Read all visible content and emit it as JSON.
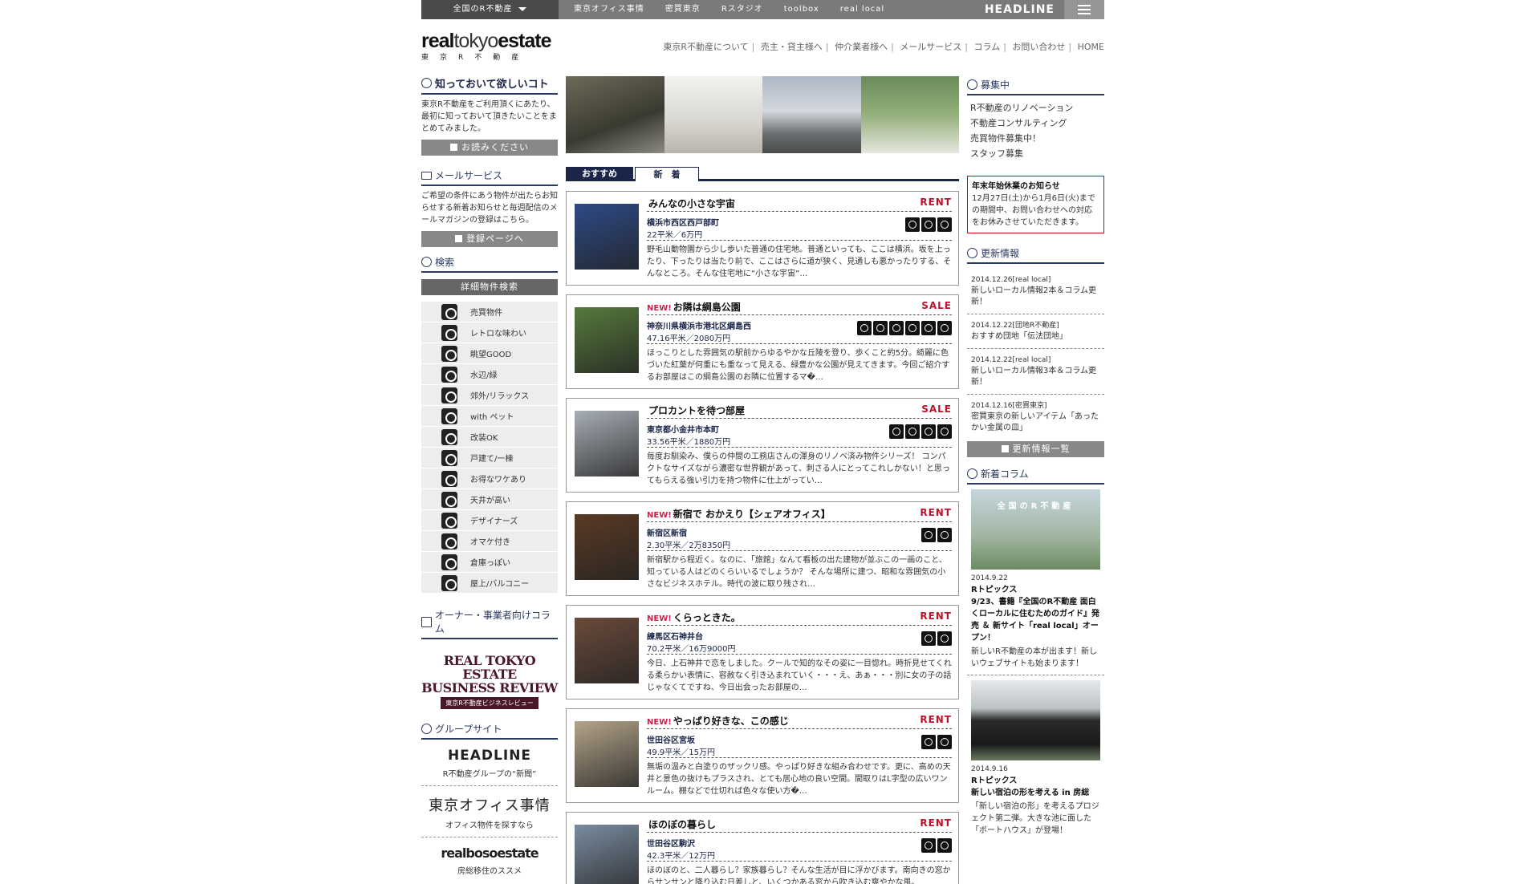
{
  "topbar": {
    "region": "全国のR不動産",
    "links": [
      "東京オフィス事情",
      "密買東京",
      "Rスタジオ",
      "toolbox",
      "real local"
    ],
    "headline": "HEADLINE"
  },
  "logo": {
    "main_bold": "real",
    "main_light": "tokyo",
    "main_bold2": "estate",
    "sub": "東京R不動産"
  },
  "gnav": [
    "東京R不動産について",
    "売主・貸主様へ",
    "仲介業者様へ",
    "メールサービス",
    "コラム",
    "お問い合わせ",
    "HOME"
  ],
  "left": {
    "know_title": "知っておいて欲しいコト",
    "know_text": "東京R不動産をご利用頂くにあたり、最初に知っておいて頂きたいことをまとめてみました。",
    "know_btn": "お読みください",
    "mail_title": "メールサービス",
    "mail_text": "ご希望の条件にあう物件が出たらお知らせする新着お知らせと毎週配信のメールマガジンの登録はこちら。",
    "mail_btn": "登録ページへ",
    "search_title": "検索",
    "search_btn": "詳細物件検索",
    "categories": [
      "売買物件",
      "レトロな味わい",
      "眺望GOOD",
      "水辺/緑",
      "郊外/リラックス",
      "with ペット",
      "改装OK",
      "戸建て/一棟",
      "お得なワケあり",
      "天井が高い",
      "デザイナーズ",
      "オマケ付き",
      "倉庫っぽい",
      "屋上/バルコニー"
    ],
    "owner_title": "オーナー・事業者向けコラム",
    "br_t1": "REAL TOKYO ESTATE",
    "br_t2": "BUSINESS REVIEW",
    "br_t3": "東京R不動産ビジネスレビュー",
    "group_title": "グループサイト",
    "groups": [
      {
        "name": "HEADLINE",
        "sub": "R不動産グループの“新聞”"
      },
      {
        "name": "東京オフィス事情",
        "sub": "オフィス物件を探すなら"
      },
      {
        "name": "realbosoestate",
        "sub": "房総移住のススメ"
      }
    ]
  },
  "tabs": {
    "recommend": "おすすめ",
    "new": "新　着"
  },
  "listings": [
    {
      "new": "",
      "title": "みんなの小さな宇宙",
      "kind": "RENT",
      "loc": "横浜市西区西戸部町",
      "price": "22平米／6万円",
      "icons": 3,
      "desc": "野毛山動物園から少し歩いた普通の住宅地。普通といっても、ここは横浜。坂を上ったり、下ったりは当たり前で、ここはさらに道が狭く、見通しも悪かったりする、そんなところ。そんな住宅地に“小さな宇宙”…",
      "thumb": "#2d4a86"
    },
    {
      "new": "NEW!",
      "title": "お隣は綱島公園",
      "kind": "SALE",
      "loc": "神奈川県横浜市港北区綱島西",
      "price": "47.16平米／2080万円",
      "icons": 6,
      "desc": "ほっこりとした雰囲気の駅前からゆるやかな丘陵を登り、歩くこと約5分。綺麗に色づいた紅葉が何重にも重なって見える、緑豊かな公園が見えてきます。今回ご紹介するお部屋はこの綱島公園のお隣に位置するマ�…",
      "thumb": "#567a3c"
    },
    {
      "new": "",
      "title": "プロカントを待つ部屋",
      "kind": "SALE",
      "loc": "東京都小金井市本町",
      "price": "33.56平米／1880万円",
      "icons": 4,
      "desc": "毎度お馴染み、僕らの仲間の工務店さんの渾身のリノベ済み物件シリーズ！ コンパクトなサイズながら濃密な世界観があって、刺さる人にとってこれしかない！と思ってもらえる強い引力を持つ物件に仕上がってい…",
      "thumb": "#a8aeb6"
    },
    {
      "new": "NEW!",
      "title": "新宿で おかえり【シェアオフィス】",
      "kind": "RENT",
      "loc": "新宿区新宿",
      "price": "2.30平米／2万8350円",
      "icons": 2,
      "desc": "新宿駅から程近く。なのに、「旅館」なんて看板の出た建物が並ぶこの一画のこと、知っている人はどのくらいいるでしょうか？ そんな場所に建つ、昭和な雰囲気の小さなビジネスホテル。時代の波に取り残され…",
      "thumb": "#5a3a24"
    },
    {
      "new": "NEW!",
      "title": "くらっときた。",
      "kind": "RENT",
      "loc": "練馬区石神井台",
      "price": "70.2平米／16万9000円",
      "icons": 2,
      "desc": "今日、上石神井で恋をしました。クールで知的なその姿に一目惚れ。時折見せてくれる柔らかい表情に、容赦なく引き込まれていく・・・え、あぁ・・・別に女の子の話じゃなくてですね、今日出会ったお部屋の…",
      "thumb": "#6a4a3a"
    },
    {
      "new": "NEW!",
      "title": "やっぱり好きな、この感じ",
      "kind": "RENT",
      "loc": "世田谷区宮坂",
      "price": "49.9平米／15万円",
      "icons": 2,
      "desc": "無垢の温みと白塗りのザックリ感。やっぱり好きな組み合わせです。更に、高めの天井と景色の抜けもプラスされ、とても居心地の良い空間。間取りはL字型の広いワンルーム。棚などで仕切れば色々な使い方�…",
      "thumb": "#b4a48a"
    },
    {
      "new": "",
      "title": "ほのぼの暮らし",
      "kind": "RENT",
      "loc": "世田谷区駒沢",
      "price": "42.3平米／12万円",
      "icons": 2,
      "desc": "ほのぼのと、二人暮らし？家族暮らし？そんな生活が目に浮かびます。南向きの窓からサンサンと降り込む日差しと、いくつかある窓から吹き込む爽やかな風。",
      "thumb": "#7a8ca0"
    }
  ],
  "right": {
    "recruit_title": "募集中",
    "recruit": [
      "R不動産のリノベーション",
      "不動産コンサルティング",
      "売買物件募集中！",
      "スタッフ募集"
    ],
    "notice_title": "年末年始休業のお知らせ",
    "notice_text": "12月27日(土)から1月6日(火)までの期間中、お問い合わせへの対応をお休みさせていただきます。",
    "update_title": "更新情報",
    "updates": [
      {
        "date": "2014.12.26[real local]",
        "text": "新しいローカル情報2本＆コラム更新！"
      },
      {
        "date": "2014.12.22[団地R不動産]",
        "text": "おすすめ団地「伝法団地」"
      },
      {
        "date": "2014.12.22[real local]",
        "text": "新しいローカル情報3本＆コラム更新！"
      },
      {
        "date": "2014.12.16[密買東京]",
        "text": "密買東京の新しいアイテム「あったかい金属の皿」"
      }
    ],
    "update_btn": "更新情報一覧",
    "column_title": "新着コラム",
    "columns": [
      {
        "thumb_text": "全国のR不動産",
        "date": "2014.9.22",
        "title": "Rトピックス\n9/23、書籍『全国のR不動産 面白くローカルに住むためのガイド』発売 ＆ 新サイト「real local」オープン！",
        "body": "新しいR不動産の本が出ます！新しいウェブサイトも始まります！"
      },
      {
        "thumb_text": "",
        "date": "2014.9.16",
        "title": "Rトピックス\n新しい宿泊の形を考える in 房総",
        "body": "「新しい宿泊の形」を考えるプロジェクト第二弾。大きな池に面した「ボートハウス」が登場！"
      }
    ]
  }
}
